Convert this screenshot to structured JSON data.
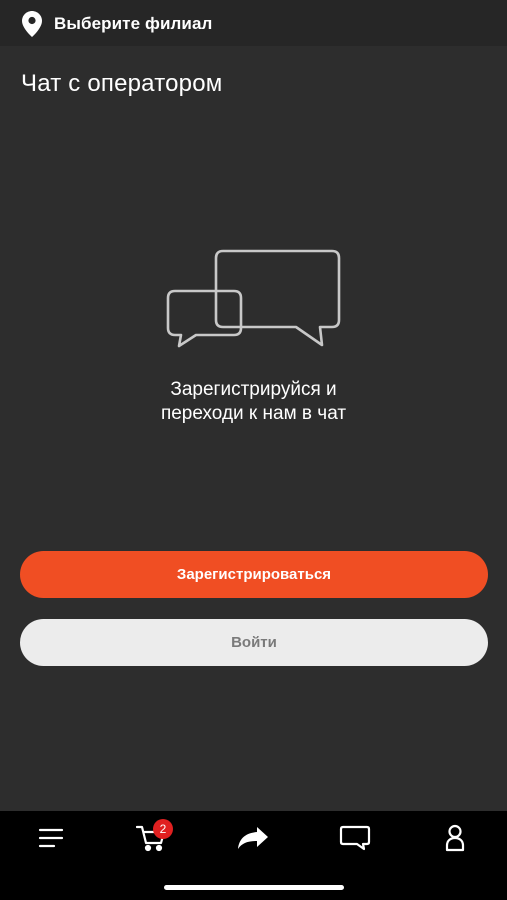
{
  "header": {
    "branch_label": "Выберите филиал",
    "branch_icon": "location-pin-icon"
  },
  "page": {
    "title": "Чат с оператором"
  },
  "empty_state": {
    "icon": "chat-bubbles-icon",
    "message_line1": "Зарегистрируйся и",
    "message_line2": "переходи к нам в чат"
  },
  "actions": {
    "register_label": "Зарегистрироваться",
    "login_label": "Войти"
  },
  "bottom_nav": {
    "items": [
      {
        "icon": "menu-icon"
      },
      {
        "icon": "cart-icon",
        "badge": "2"
      },
      {
        "icon": "share-icon"
      },
      {
        "icon": "chat-icon"
      },
      {
        "icon": "profile-icon"
      }
    ]
  },
  "colors": {
    "background": "#2d2d2d",
    "accent": "#f04e23",
    "secondary_button": "#ececec",
    "nav_background": "#000000",
    "badge": "#e02020"
  }
}
